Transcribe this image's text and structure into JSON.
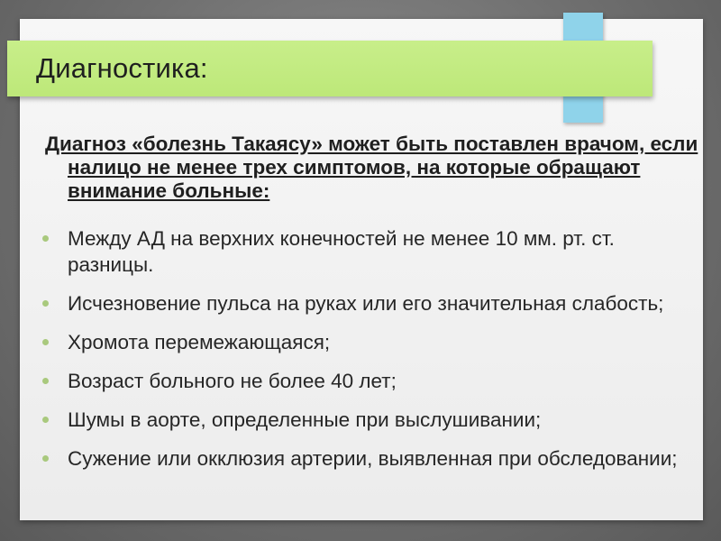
{
  "slide": {
    "title": "Диагностика:",
    "intro": "Диагноз «болезнь Такаясу» может быть поставлен врачом, если налицо не менее трех симптомов, на которые обращают внимание больные:",
    "bullets": [
      "Между АД на верхних конечностей не менее 10 мм. рт. ст. разницы.",
      "Исчезновение пульса на руках или его значительная слабость;",
      "Хромота перемежающаяся;",
      "Возраст больного не более 40 лет;",
      "Шумы в аорте, определенные при выслушивании;",
      "Сужение или окклюзия артерии, выявленная при обследовании;"
    ]
  },
  "colors": {
    "title_band": "#c4ec82",
    "accent_bar": "#8fd3ea",
    "bullet": "#a9c97d",
    "background": "#7a7a7a"
  }
}
